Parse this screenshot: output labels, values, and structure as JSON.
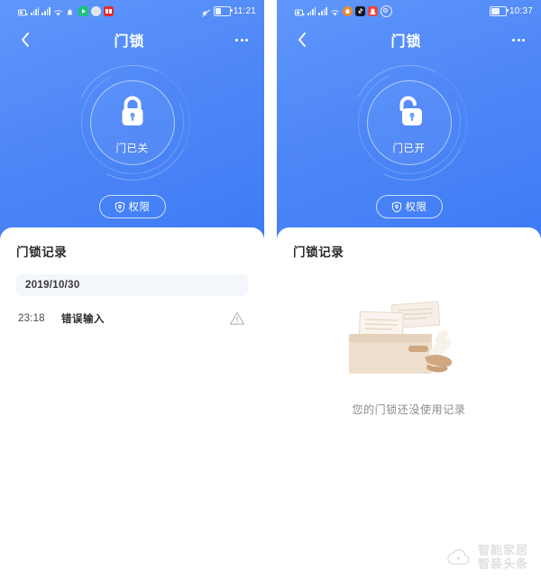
{
  "meta": {
    "accent_blue": "#4f87f7",
    "hero_gradient_from": "#5f97fb",
    "hero_gradient_to": "#3d7bf5",
    "card_bg": "#ffffff",
    "chip_bg": "#f3f6fa",
    "illustration_base": "#ead8c6",
    "illustration_paper": "#f7f1e9",
    "illustration_hand": "#cfa882"
  },
  "screens": [
    {
      "id": "locked",
      "status_bar": {
        "time": "11:21",
        "icons": [
          "sim-card-icon",
          "signal-bars-icon",
          "signal-bars-icon",
          "wifi-icon",
          "notification-dot-icon",
          "play-app-icon",
          "message-app-icon",
          "red-app-icon"
        ],
        "right_icons": [
          "mute-icon",
          "battery-icon"
        ]
      },
      "nav": {
        "back_icon": "chevron-left-icon",
        "title": "门锁",
        "more_icon": "more-dots-icon"
      },
      "lock": {
        "icon": "lock-closed-icon",
        "status_label": "门已关"
      },
      "permission_button": {
        "icon": "shield-keyhole-icon",
        "label": "权限"
      },
      "records": {
        "title": "门锁记录",
        "has_records": true,
        "date_group": "2019/10/30",
        "entries": [
          {
            "time": "23:18",
            "event": "错误输入",
            "status_icon": "warning-triangle-icon"
          }
        ]
      }
    },
    {
      "id": "unlocked",
      "status_bar": {
        "time": "10:37",
        "icons": [
          "sim-card-icon",
          "signal-bars-icon",
          "signal-bars-icon",
          "wifi-icon",
          "orange-app-icon",
          "tiktok-app-icon",
          "red-app-icon",
          "circle-app-icon"
        ],
        "right_icons": [
          "battery-icon"
        ]
      },
      "nav": {
        "back_icon": "chevron-left-icon",
        "title": "门锁",
        "more_icon": "more-dots-icon"
      },
      "lock": {
        "icon": "lock-open-icon",
        "status_label": "门已开"
      },
      "permission_button": {
        "icon": "shield-keyhole-icon",
        "label": "权限"
      },
      "records": {
        "title": "门锁记录",
        "has_records": false,
        "empty_illustration": "empty-box-papers-icon",
        "empty_text": "您的门锁还没使用记录"
      }
    }
  ],
  "watermark": {
    "logo_icon": "cloud-logo-icon",
    "line1": "智能家居",
    "line2": "智装头条"
  }
}
